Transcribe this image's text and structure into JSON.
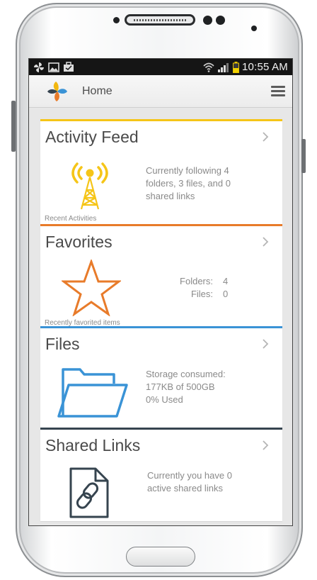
{
  "status_bar": {
    "time": "10:55 AM"
  },
  "app_bar": {
    "title": "Home"
  },
  "cards": {
    "activity": {
      "title": "Activity Feed",
      "caption": "Recent Activities",
      "text_lines": [
        "Currently following 4",
        "folders, 3 files, and 0",
        "shared links"
      ]
    },
    "favorites": {
      "title": "Favorites",
      "caption": "Recently favorited items",
      "folders_label": "Folders:",
      "folders_value": "4",
      "files_label": "Files:",
      "files_value": "0"
    },
    "files": {
      "title": "Files",
      "text_lines": [
        "Storage consumed:",
        "177KB of 500GB",
        "0% Used"
      ]
    },
    "shared_links": {
      "title": "Shared Links",
      "text_lines": [
        "Currently you have 0",
        "active shared links"
      ]
    }
  },
  "colors": {
    "activity": "#f5c518",
    "favorites": "#e87b2a",
    "files": "#3a93d6",
    "shared_links": "#36444f"
  },
  "icons": {
    "status_left": [
      "pinwheel-icon",
      "image-icon",
      "briefcase-icon"
    ],
    "status_right": [
      "wifi-icon",
      "signal-icon",
      "battery-icon"
    ],
    "app_logo": "pinwheel-logo",
    "menu": "hamburger-menu-icon",
    "activity": "broadcast-tower-icon",
    "favorites": "star-icon",
    "files": "folder-icon",
    "shared_links": "link-document-icon"
  }
}
